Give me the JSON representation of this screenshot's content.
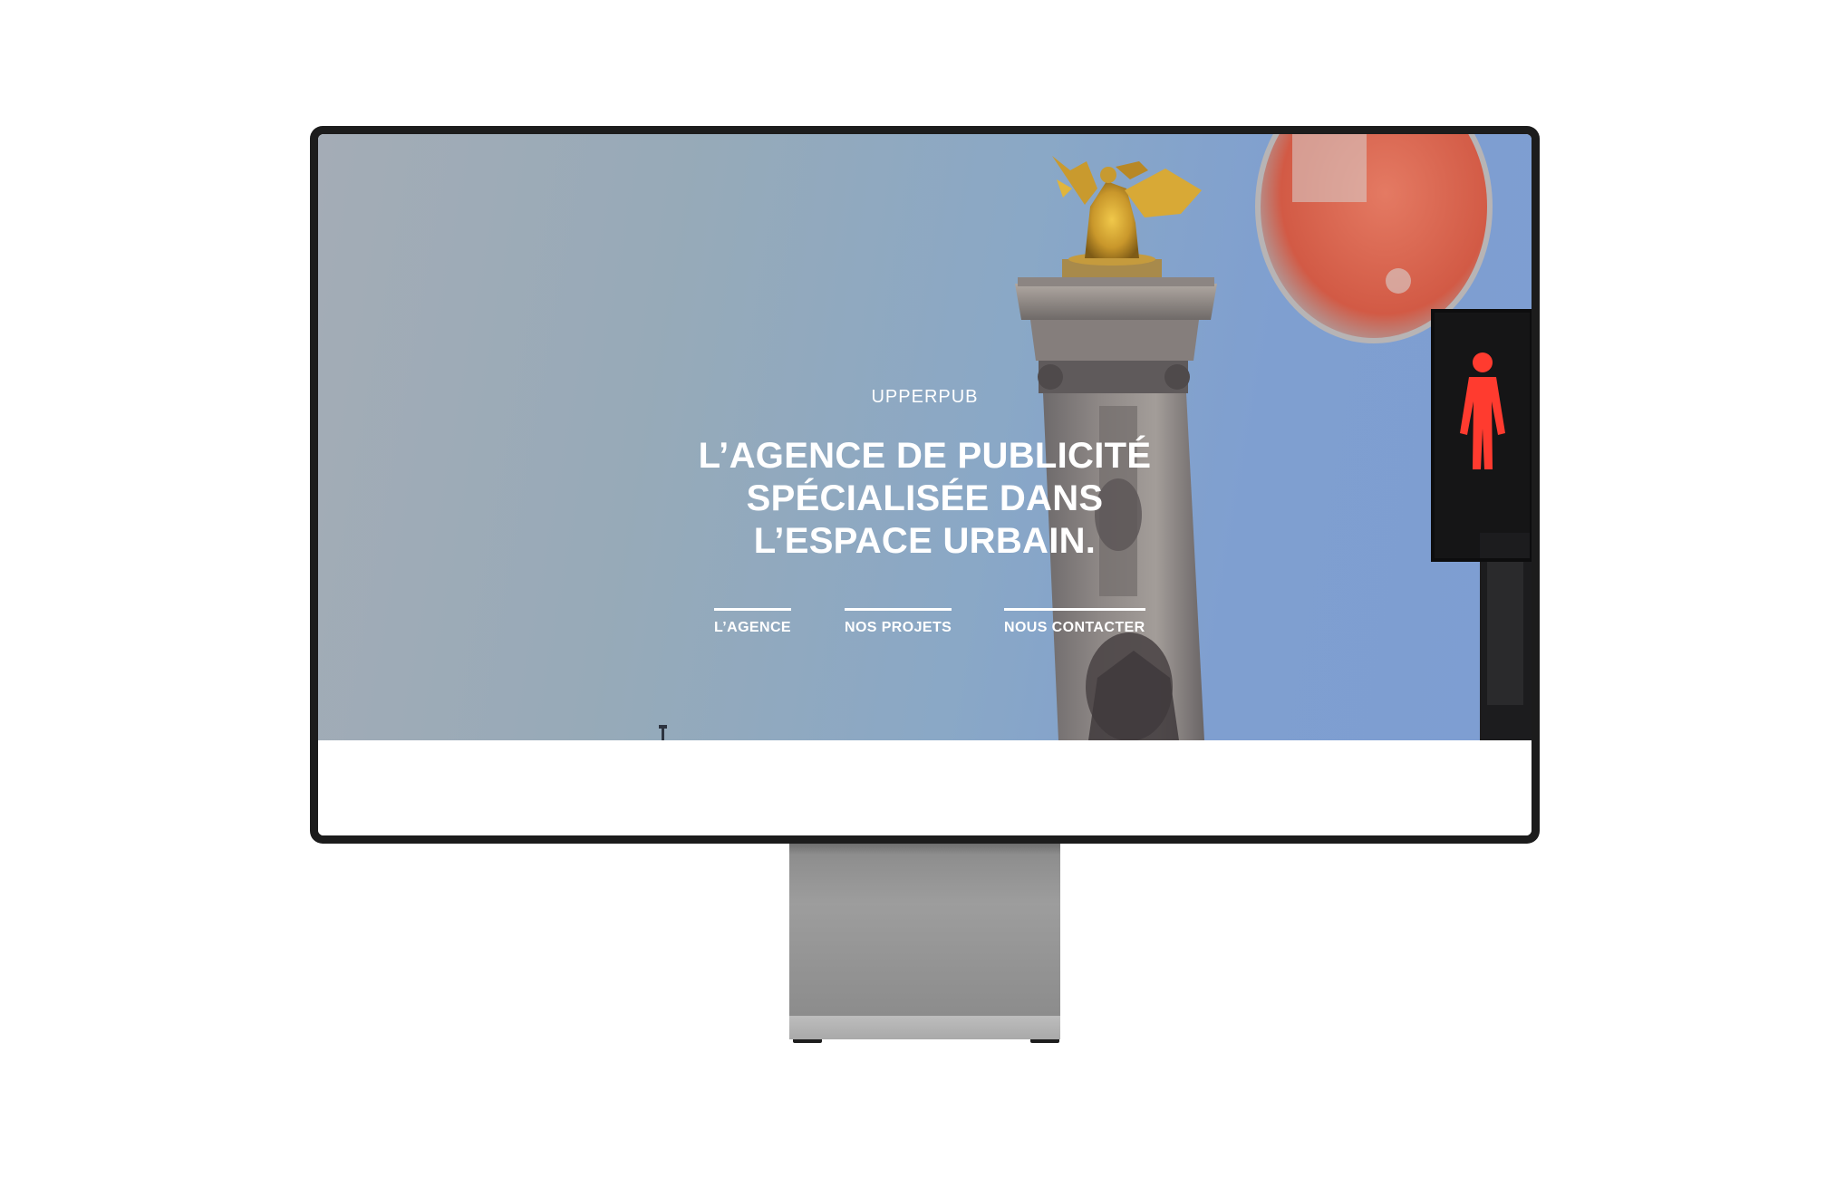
{
  "site": {
    "brand": "UPPERPUB",
    "headline": [
      "L’AGENCE DE PUBLICITÉ",
      "SPÉCIALISÉE DANS",
      "L’ESPACE URBAIN."
    ]
  },
  "nav": {
    "items": [
      {
        "label": "L’AGENCE"
      },
      {
        "label": "NOS PROJETS"
      },
      {
        "label": "NOUS CONTACTER"
      }
    ]
  },
  "colors": {
    "sky_left": "#a4acb6",
    "sky_right": "#7e9ed2",
    "text": "#ffffff",
    "bezel": "#1c1c1c",
    "stand": "#9d9d9d",
    "signal_red": "#ff3b2f"
  }
}
